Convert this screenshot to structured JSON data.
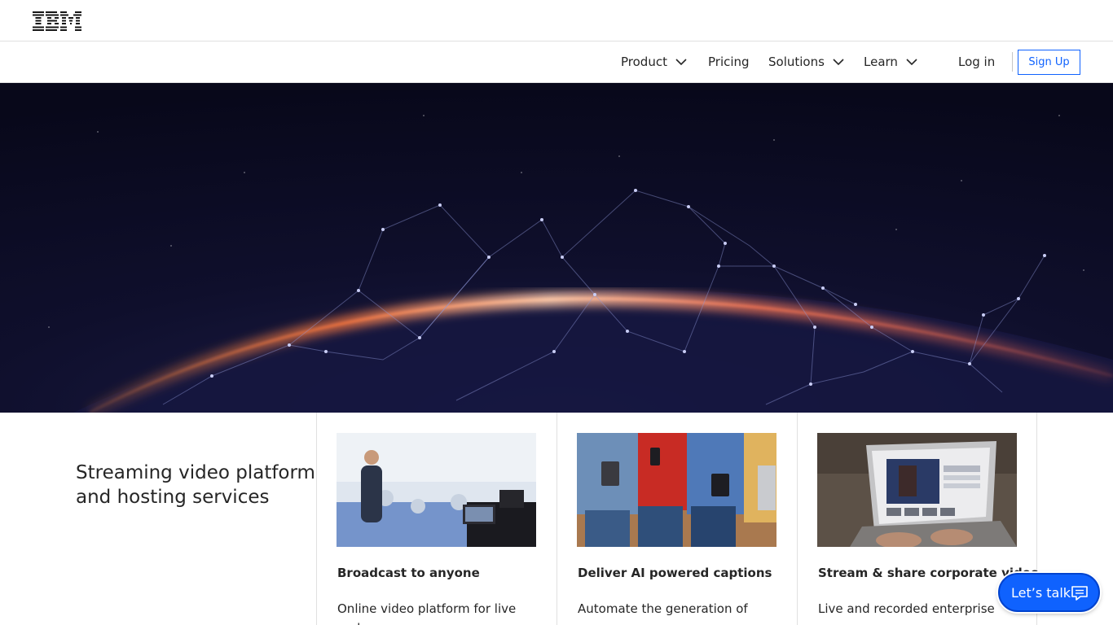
{
  "brand": {
    "logo_text": "IBM"
  },
  "nav": {
    "items": [
      {
        "label": "Product",
        "has_dropdown": true
      },
      {
        "label": "Pricing",
        "has_dropdown": false
      },
      {
        "label": "Solutions",
        "has_dropdown": true
      },
      {
        "label": "Learn",
        "has_dropdown": true
      }
    ],
    "login_label": "Log in",
    "signup_label": "Sign Up"
  },
  "hero": {
    "image": "network-globe-hero"
  },
  "main": {
    "title": "Streaming video platform and hosting services",
    "cards": [
      {
        "image": "broadcast-camera-photo",
        "title": "Broadcast to anyone",
        "text": "Online video platform for live and"
      },
      {
        "image": "people-devices-photo",
        "title": "Deliver AI powered captions",
        "text": "Automate the generation of"
      },
      {
        "image": "laptop-video-photo",
        "title": "Stream & share corporate video",
        "text": "Live and recorded enterprise"
      }
    ]
  },
  "chat": {
    "label": "Let’s talk",
    "icon": "chat-icon"
  },
  "colors": {
    "accent": "#0f62fe",
    "text": "#262626",
    "hero_bg": "#0f0f2c"
  }
}
